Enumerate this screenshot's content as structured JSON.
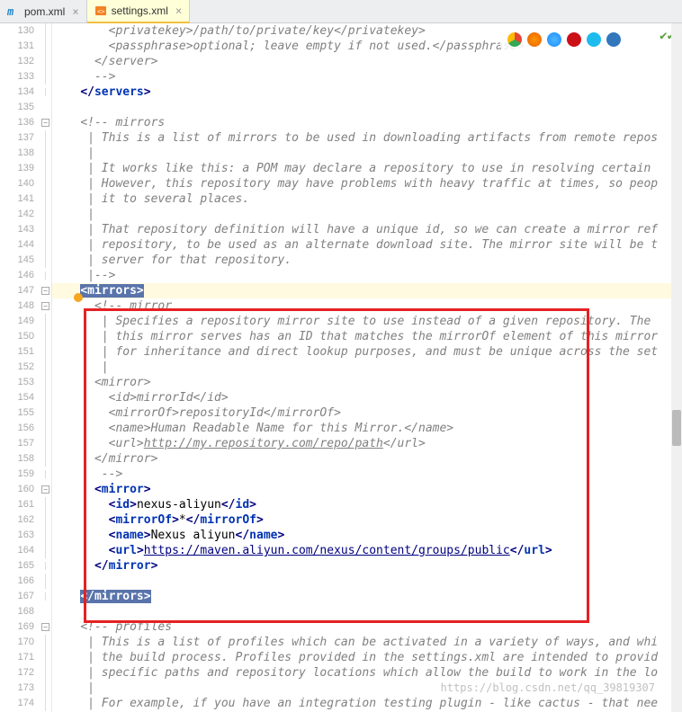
{
  "tabs": [
    {
      "label": "pom.xml",
      "active": false,
      "iconColor": "#2889c7"
    },
    {
      "label": "settings.xml",
      "active": true,
      "iconColor": "#f58220"
    }
  ],
  "lineStart": 130,
  "lineEnd": 174,
  "highlightedLine": 147,
  "annotationLine": 146,
  "code": [
    {
      "n": 130,
      "style": "comment",
      "indent": "        ",
      "text": "<privatekey>/path/to/private/key</privatekey>"
    },
    {
      "n": 131,
      "style": "comment",
      "indent": "        ",
      "text": "<passphrase>optional; leave empty if not used.</passphrase>"
    },
    {
      "n": 132,
      "style": "comment",
      "indent": "      ",
      "text": "</server>"
    },
    {
      "n": 133,
      "style": "comment",
      "indent": "      ",
      "text": "-->"
    },
    {
      "n": 134,
      "style": "tag",
      "indent": "    ",
      "open": "</",
      "name": "servers",
      "close": ">"
    },
    {
      "n": 135,
      "style": "blank",
      "indent": "",
      "text": ""
    },
    {
      "n": 136,
      "style": "comment",
      "indent": "    ",
      "text": "<!-- mirrors"
    },
    {
      "n": 137,
      "style": "comment",
      "indent": "     ",
      "text": "| This is a list of mirrors to be used in downloading artifacts from remote repos"
    },
    {
      "n": 138,
      "style": "comment",
      "indent": "     ",
      "text": "|"
    },
    {
      "n": 139,
      "style": "comment",
      "indent": "     ",
      "text": "| It works like this: a POM may declare a repository to use in resolving certain "
    },
    {
      "n": 140,
      "style": "comment",
      "indent": "     ",
      "text": "| However, this repository may have problems with heavy traffic at times, so peop"
    },
    {
      "n": 141,
      "style": "comment",
      "indent": "     ",
      "text": "| it to several places."
    },
    {
      "n": 142,
      "style": "comment",
      "indent": "     ",
      "text": "|"
    },
    {
      "n": 143,
      "style": "comment",
      "indent": "     ",
      "text": "| That repository definition will have a unique id, so we can create a mirror ref"
    },
    {
      "n": 144,
      "style": "comment",
      "indent": "     ",
      "text": "| repository, to be used as an alternate download site. The mirror site will be t"
    },
    {
      "n": 145,
      "style": "comment",
      "indent": "     ",
      "text": "| server for that repository."
    },
    {
      "n": 146,
      "style": "comment",
      "indent": "     ",
      "text": "|-->"
    },
    {
      "n": 147,
      "style": "sel",
      "indent": "    ",
      "open": "<",
      "name": "mirrors",
      "close": ">",
      "current": true
    },
    {
      "n": 148,
      "style": "comment",
      "indent": "      ",
      "text": "<!-- mirror"
    },
    {
      "n": 149,
      "style": "comment",
      "indent": "       ",
      "text": "| Specifies a repository mirror site to use instead of a given repository. The "
    },
    {
      "n": 150,
      "style": "comment",
      "indent": "       ",
      "text": "| this mirror serves has an ID that matches the mirrorOf element of this mirror"
    },
    {
      "n": 151,
      "style": "comment",
      "indent": "       ",
      "text": "| for inheritance and direct lookup purposes, and must be unique across the set"
    },
    {
      "n": 152,
      "style": "comment",
      "indent": "       ",
      "text": "|"
    },
    {
      "n": 153,
      "style": "comment",
      "indent": "      ",
      "text": "<mirror>"
    },
    {
      "n": 154,
      "style": "comment",
      "indent": "        ",
      "text": "<id>mirrorId</id>"
    },
    {
      "n": 155,
      "style": "comment",
      "indent": "        ",
      "text": "<mirrorOf>repositoryId</mirrorOf>"
    },
    {
      "n": 156,
      "style": "comment",
      "indent": "        ",
      "text": "<name>Human Readable Name for this Mirror.</name>"
    },
    {
      "n": 157,
      "style": "commentlink",
      "indent": "        ",
      "pre": "<url>",
      "link": "http://my.repository.com/repo/path",
      "post": "</url>"
    },
    {
      "n": 158,
      "style": "comment",
      "indent": "      ",
      "text": "</mirror>"
    },
    {
      "n": 159,
      "style": "comment",
      "indent": "       ",
      "text": "-->"
    },
    {
      "n": 160,
      "style": "tag",
      "indent": "      ",
      "open": "<",
      "name": "mirror",
      "close": ">"
    },
    {
      "n": 161,
      "style": "elem",
      "indent": "        ",
      "name": "id",
      "value": "nexus-aliyun"
    },
    {
      "n": 162,
      "style": "elem",
      "indent": "        ",
      "name": "mirrorOf",
      "value": "*"
    },
    {
      "n": 163,
      "style": "elem",
      "indent": "        ",
      "name": "name",
      "value": "Nexus aliyun"
    },
    {
      "n": 164,
      "style": "elemlink",
      "indent": "        ",
      "name": "url",
      "link": "https://maven.aliyun.com/nexus/content/groups/public"
    },
    {
      "n": 165,
      "style": "tag",
      "indent": "      ",
      "open": "</",
      "name": "mirror",
      "close": ">"
    },
    {
      "n": 166,
      "style": "blank",
      "indent": "",
      "text": ""
    },
    {
      "n": 167,
      "style": "sel",
      "indent": "    ",
      "open": "</",
      "name": "mirrors",
      "close": ">"
    },
    {
      "n": 168,
      "style": "blank",
      "indent": "",
      "text": ""
    },
    {
      "n": 169,
      "style": "comment",
      "indent": "    ",
      "text": "<!-- profiles"
    },
    {
      "n": 170,
      "style": "comment",
      "indent": "     ",
      "text": "| This is a list of profiles which can be activated in a variety of ways, and whi"
    },
    {
      "n": 171,
      "style": "comment",
      "indent": "     ",
      "text": "| the build process. Profiles provided in the settings.xml are intended to provid"
    },
    {
      "n": 172,
      "style": "comment",
      "indent": "     ",
      "text": "| specific paths and repository locations which allow the build to work in the lo"
    },
    {
      "n": 173,
      "style": "comment",
      "indent": "     ",
      "text": "|"
    },
    {
      "n": 174,
      "style": "comment",
      "indent": "     ",
      "text": "| For example, if you have an integration testing plugin - like cactus - that nee"
    }
  ],
  "foldMarkers": {
    "130": "line",
    "131": "line",
    "132": "line",
    "133": "line",
    "134": "end",
    "135": "",
    "136": "minus",
    "137": "line",
    "138": "line",
    "139": "line",
    "140": "line",
    "141": "line",
    "142": "line",
    "143": "line",
    "144": "line",
    "145": "line",
    "146": "end",
    "147": "minus",
    "148": "minus",
    "149": "line",
    "150": "line",
    "151": "line",
    "152": "line",
    "153": "line",
    "154": "line",
    "155": "line",
    "156": "line",
    "157": "line",
    "158": "line",
    "159": "end",
    "160": "minus",
    "161": "line",
    "162": "line",
    "163": "line",
    "164": "line",
    "165": "end",
    "166": "line",
    "167": "end",
    "168": "",
    "169": "minus",
    "170": "line",
    "171": "line",
    "172": "line",
    "173": "line",
    "174": "line"
  },
  "browserIcons": [
    "chrome",
    "firefox",
    "safari",
    "opera",
    "ie",
    "edge"
  ],
  "watermark": "https://blog.csdn.net/qq_39819307"
}
